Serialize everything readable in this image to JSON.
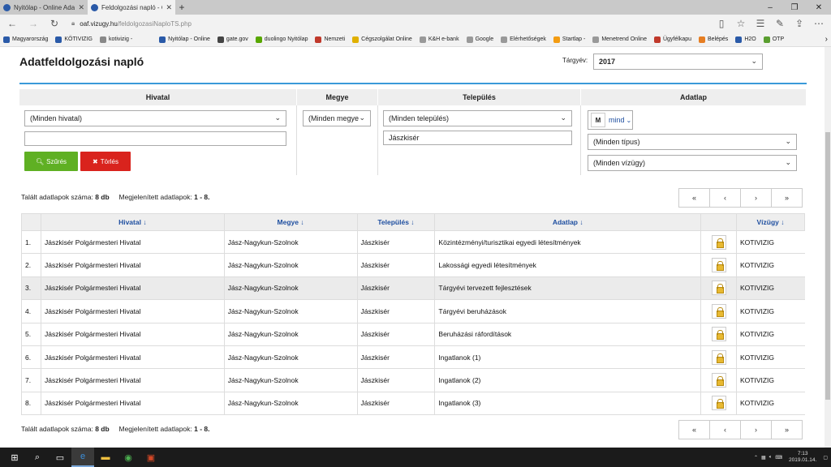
{
  "browser": {
    "tabs": [
      {
        "title": "Nyitólap - Online Adatfeldo",
        "active": false
      },
      {
        "title": "Feldolgozási napló - Or",
        "active": true
      }
    ],
    "url_host": "oaf.vizugy.hu",
    "url_path": "/feldolgozasiNaploTS.php"
  },
  "bookmarks": [
    "Magyarország",
    "KÖTIVIZIG",
    "kotivizig -",
    "Nyitólap - Online",
    "gate.gov",
    "duolingo Nyitólap",
    "Nemzeti",
    "Cégszolgálat Online",
    "K&H e-bank",
    "Google",
    "Elérhetőségek",
    "Startlap -",
    "Menetrend Online",
    "Ügyfélkapu",
    "Belépés",
    "H2O",
    "OTP"
  ],
  "page": {
    "title": "Adatfeldolgozási napló",
    "year_label": "Tárgyév:",
    "year_value": "2017"
  },
  "filters": {
    "headers": {
      "hivatal": "Hivatal",
      "megye": "Megye",
      "telepules": "Település",
      "adatlap": "Adatlap"
    },
    "hivatal_select": "(Minden hivatal)",
    "hivatal_text": "",
    "megye_select": "(Minden megye",
    "telepules_select": "(Minden település)",
    "telepules_text": "Jászkisér",
    "mode_letter": "M",
    "mode_value": "mind",
    "tipus_select": "(Minden típus)",
    "vizugy_select": "(Minden vízügy)",
    "filter_button": "Szűrés",
    "clear_button": "Törlés"
  },
  "summary": {
    "found_label": "Talált adatlapok száma:",
    "found_value": "8 db",
    "shown_label": "Megjelenített adatlapok:",
    "shown_value": "1 - 8."
  },
  "pager": [
    "«",
    "‹",
    "›",
    "»"
  ],
  "table": {
    "headers": {
      "hivatal": "Hivatal",
      "megye": "Megye",
      "telepules": "Település",
      "adatlap": "Adatlap",
      "vizugy": "Vízügy"
    },
    "rows": [
      {
        "n": "1.",
        "hivatal": "Jászkisér Polgármesteri Hivatal",
        "megye": "Jász-Nagykun-Szolnok",
        "telepules": "Jászkisér",
        "adatlap": "Közintézményi/turisztikai egyedi létesítmények",
        "vizugy": "KOTIVIZIG"
      },
      {
        "n": "2.",
        "hivatal": "Jászkisér Polgármesteri Hivatal",
        "megye": "Jász-Nagykun-Szolnok",
        "telepules": "Jászkisér",
        "adatlap": "Lakossági egyedi létesítmények",
        "vizugy": "KOTIVIZIG"
      },
      {
        "n": "3.",
        "hivatal": "Jászkisér Polgármesteri Hivatal",
        "megye": "Jász-Nagykun-Szolnok",
        "telepules": "Jászkisér",
        "adatlap": "Tárgyévi tervezett fejlesztések",
        "vizugy": "KOTIVIZIG"
      },
      {
        "n": "4.",
        "hivatal": "Jászkisér Polgármesteri Hivatal",
        "megye": "Jász-Nagykun-Szolnok",
        "telepules": "Jászkisér",
        "adatlap": "Tárgyévi beruházások",
        "vizugy": "KOTIVIZIG"
      },
      {
        "n": "5.",
        "hivatal": "Jászkisér Polgármesteri Hivatal",
        "megye": "Jász-Nagykun-Szolnok",
        "telepules": "Jászkisér",
        "adatlap": "Beruházási ráfordítások",
        "vizugy": "KOTIVIZIG"
      },
      {
        "n": "6.",
        "hivatal": "Jászkisér Polgármesteri Hivatal",
        "megye": "Jász-Nagykun-Szolnok",
        "telepules": "Jászkisér",
        "adatlap": "Ingatlanok (1)",
        "vizugy": "KOTIVIZIG"
      },
      {
        "n": "7.",
        "hivatal": "Jászkisér Polgármesteri Hivatal",
        "megye": "Jász-Nagykun-Szolnok",
        "telepules": "Jászkisér",
        "adatlap": "Ingatlanok (2)",
        "vizugy": "KOTIVIZIG"
      },
      {
        "n": "8.",
        "hivatal": "Jászkisér Polgármesteri Hivatal",
        "megye": "Jász-Nagykun-Szolnok",
        "telepules": "Jászkisér",
        "adatlap": "Ingatlanok (3)",
        "vizugy": "KOTIVIZIG"
      }
    ]
  },
  "taskbar": {
    "time": "7:13",
    "date": "2019.01.14."
  },
  "colors": {
    "accent_line": "#3a9ad9",
    "filter_button": "#5fb023",
    "clear_button": "#d9231d",
    "link_blue": "#1f4fa0"
  }
}
